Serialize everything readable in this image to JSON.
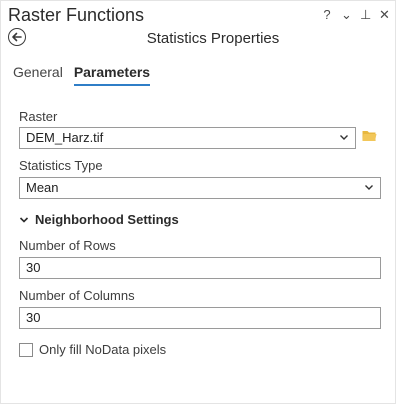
{
  "window": {
    "title": "Raster Functions",
    "controls": {
      "help": "?",
      "menu": "⌄",
      "pin": "⊥",
      "close": "✕"
    }
  },
  "header": {
    "title": "Statistics Properties"
  },
  "tabs": [
    {
      "label": "General",
      "active": false
    },
    {
      "label": "Parameters",
      "active": true
    }
  ],
  "raster": {
    "label": "Raster",
    "value": "DEM_Harz.tif"
  },
  "statistics_type": {
    "label": "Statistics Type",
    "value": "Mean"
  },
  "neighborhood": {
    "label": "Neighborhood Settings",
    "rows": {
      "label": "Number of Rows",
      "value": "30"
    },
    "columns": {
      "label": "Number of Columns",
      "value": "30"
    }
  },
  "nodata": {
    "label": "Only fill NoData pixels",
    "checked": false
  },
  "colors": {
    "accent": "#2f7ec7",
    "folder": "#e8b840"
  }
}
